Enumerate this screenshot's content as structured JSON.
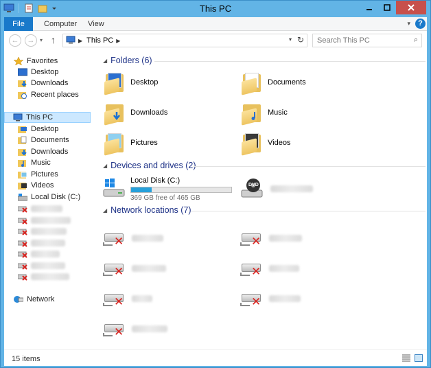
{
  "window": {
    "title": "This PC"
  },
  "ribbon": {
    "tabs": [
      "File",
      "Computer",
      "View"
    ],
    "help": "?"
  },
  "address": {
    "crumb": "This PC"
  },
  "search": {
    "placeholder": "Search This PC"
  },
  "nav": {
    "favorites_label": "Favorites",
    "favorites": [
      "Desktop",
      "Downloads",
      "Recent places"
    ],
    "thispc_label": "This PC",
    "thispc": [
      "Desktop",
      "Documents",
      "Downloads",
      "Music",
      "Pictures",
      "Videos",
      "Local Disk (C:)"
    ],
    "network_label": "Network"
  },
  "content": {
    "folders_header": "Folders (6)",
    "folders": [
      "Desktop",
      "Documents",
      "Downloads",
      "Music",
      "Pictures",
      "Videos"
    ],
    "devices_header": "Devices and drives (2)",
    "drive": {
      "name": "Local Disk (C:)",
      "free_text": "369 GB free of 465 GB",
      "used_fraction": 0.206
    },
    "dvd_badge": "DVD",
    "network_header": "Network locations (7)"
  },
  "status": {
    "count": "15 items"
  },
  "colors": {
    "accent": "#1979ca",
    "title_bg": "#62b4e6",
    "header_text": "#1e3287",
    "drive_fill": "#26a0da",
    "error_red": "#d9231f"
  }
}
